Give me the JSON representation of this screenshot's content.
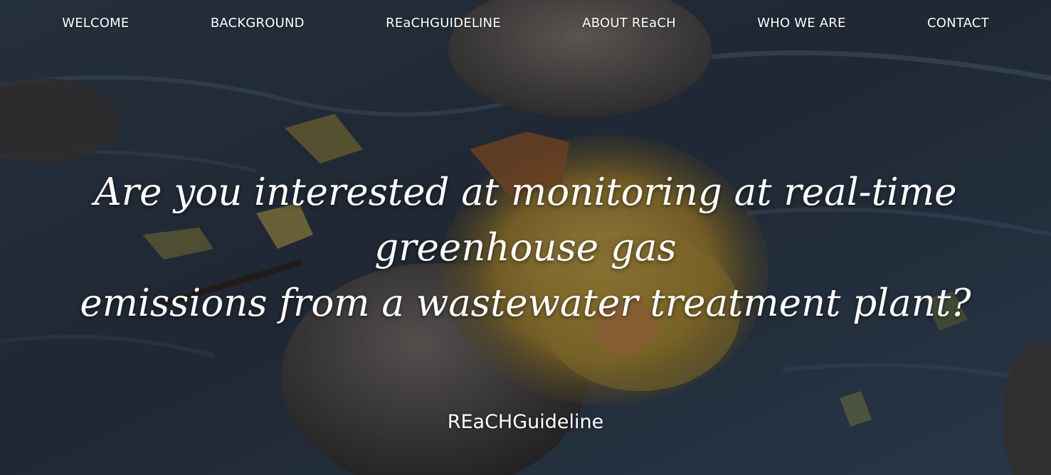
{
  "nav": {
    "items": [
      {
        "label": "WELCOME"
      },
      {
        "label": "BACKGROUND"
      },
      {
        "label": "REaCHGUIDELINE"
      },
      {
        "label": "ABOUT REaCH"
      },
      {
        "label": "WHO WE ARE"
      },
      {
        "label": "CONTACT"
      }
    ]
  },
  "hero": {
    "headline_line1": "Are you interested at monitoring at real-time greenhouse gas",
    "headline_line2": "emissions from a wastewater treatment plant?",
    "site_label": "REaCHGuideline",
    "background_image": "stream-with-rocks-and-autumn-leaves",
    "colors": {
      "water_dark": "#1f2a36",
      "water_blue": "#3e556b",
      "rock": "#5b5754",
      "leaf_gold": "#b99a3a",
      "leaf_orange": "#a5652e"
    }
  }
}
